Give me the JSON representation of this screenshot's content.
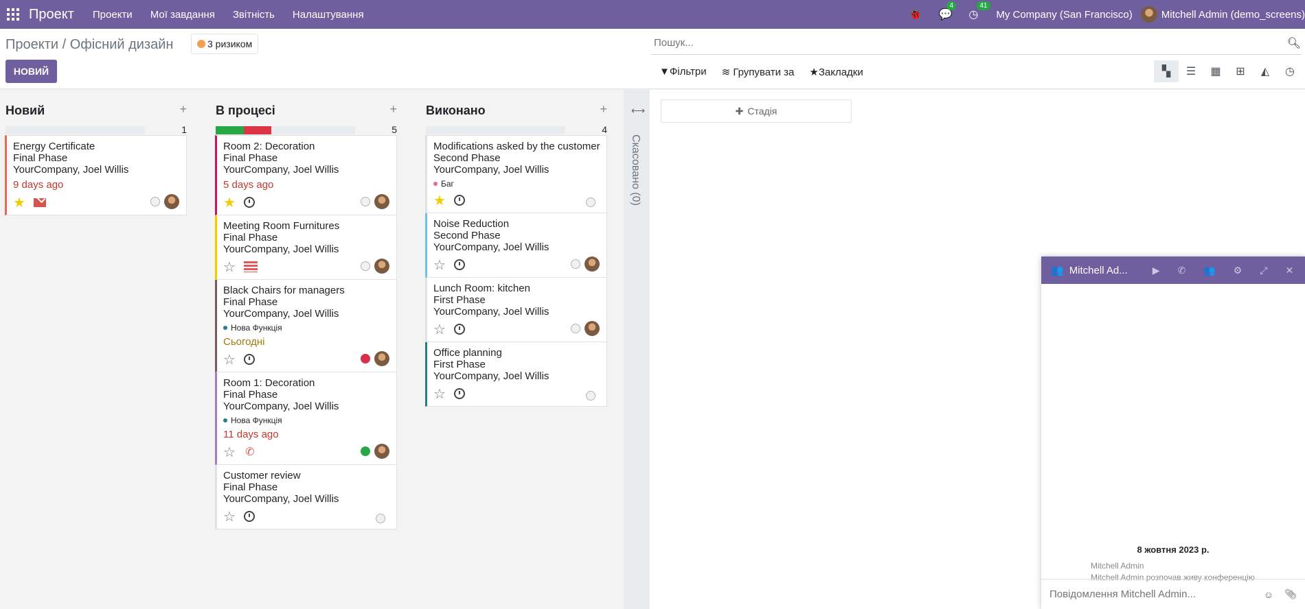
{
  "navbar": {
    "brand": "Проект",
    "menu": [
      "Проекти",
      "Мої завдання",
      "Звітність",
      "Налаштування"
    ],
    "messages_count": "4",
    "activities_count": "41",
    "company": "My Company (San Francisco)",
    "user": "Mitchell Admin (demo_screens)"
  },
  "control_panel": {
    "breadcrumb": "Проекти / Офісний дизайн",
    "risk_label": "3 ризиком",
    "new_button": "НОВИЙ",
    "search_placeholder": "Пошук...",
    "filters_label": "Фільтри",
    "group_by_label": "Групувати за",
    "favorites_label": "Закладки"
  },
  "columns": [
    {
      "title": "Новий",
      "count": "1",
      "progress": [],
      "cards": [
        {
          "title": "Energy Certificate",
          "stage": "Final Phase",
          "customer": "YourCompany, Joel Willis",
          "date": "9 days ago",
          "date_color": "#c0392b",
          "starred": true,
          "activity": "mail",
          "state": "normal",
          "border": "#e8694f"
        }
      ]
    },
    {
      "title": "В процесі",
      "count": "5",
      "progress": [
        {
          "fraction": 0.2,
          "color": "#28a745"
        },
        {
          "fraction": 0.2,
          "color": "#dc3545"
        }
      ],
      "cards": [
        {
          "title": "Room 2: Decoration",
          "stage": "Final Phase",
          "customer": "YourCompany, Joel Willis",
          "date": "5 days ago",
          "date_color": "#c0392b",
          "starred": true,
          "activity": "clock",
          "state": "normal",
          "border": "#c2185b"
        },
        {
          "title": "Meeting Room Furnitures",
          "stage": "Final Phase",
          "customer": "YourCompany, Joel Willis",
          "starred": false,
          "activity": "doc",
          "state": "normal",
          "border": "#f3cc00"
        },
        {
          "title": "Black Chairs for managers",
          "stage": "Final Phase",
          "customer": "YourCompany, Joel Willis",
          "tag": "Нова Функція",
          "tag_color": "#2a7a8a",
          "date": "Сьогодні",
          "date_color": "#a07a00",
          "starred": false,
          "activity": "clock",
          "state": "red",
          "border": "#7a5c5c"
        },
        {
          "title": "Room 1: Decoration",
          "stage": "Final Phase",
          "customer": "YourCompany, Joel Willis",
          "tag": "Нова Функція",
          "tag_color": "#2a7a8a",
          "date": "11 days ago",
          "date_color": "#c0392b",
          "starred": false,
          "activity": "phone",
          "state": "green",
          "border": "#a77cc2"
        },
        {
          "title": "Customer review",
          "stage": "Final Phase",
          "customer": "YourCompany, Joel Willis",
          "starred": false,
          "activity": "clock",
          "state": "normal",
          "border": "#dee2e6",
          "no_avatar": true
        }
      ]
    },
    {
      "title": "Виконано",
      "count": "4",
      "progress": [],
      "cards": [
        {
          "title": "Modifications asked by the customer",
          "stage": "Second Phase",
          "customer": "YourCompany, Joel Willis",
          "tag": "Баг",
          "tag_color": "#e86c8a",
          "starred": true,
          "activity": "clock",
          "state": "normal",
          "border": "#dee2e6",
          "no_avatar": true
        },
        {
          "title": "Noise Reduction",
          "stage": "Second Phase",
          "customer": "YourCompany, Joel Willis",
          "starred": false,
          "activity": "clock",
          "state": "normal",
          "border": "#6ec1e4"
        },
        {
          "title": "Lunch Room: kitchen",
          "stage": "First Phase",
          "customer": "YourCompany, Joel Willis",
          "starred": false,
          "activity": "clock",
          "state": "normal",
          "border": "#dee2e6"
        },
        {
          "title": "Office planning",
          "stage": "First Phase",
          "customer": "YourCompany, Joel Willis",
          "starred": false,
          "activity": "clock",
          "state": "normal",
          "border": "#2a7a8a",
          "no_avatar": true
        }
      ]
    }
  ],
  "folded_column": "Скасовано (0)",
  "add_stage": "Стадія",
  "chat": {
    "title": "Mitchell Ad...",
    "date": "8 жовтня 2023 р.",
    "author": "Mitchell Admin",
    "message": "Mitchell Admin розпочав живу конференцію",
    "input_placeholder": "Повідомлення Mitchell Admin..."
  }
}
